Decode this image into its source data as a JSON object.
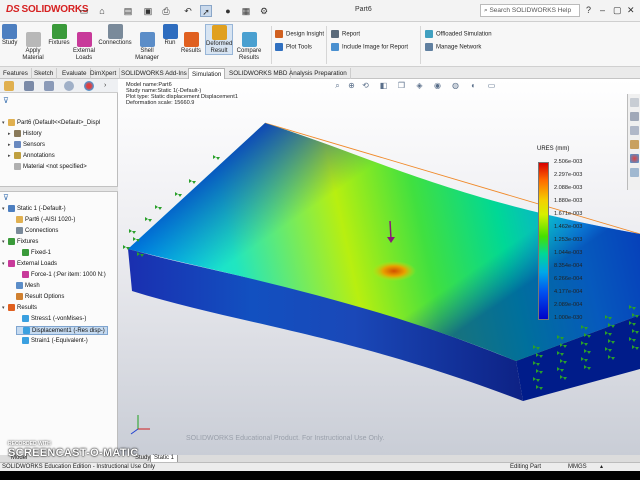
{
  "app": {
    "logo": "SOLIDWORKS",
    "doc_title": "Part6",
    "search_placeholder": "Search SOLIDWORKS Help"
  },
  "ribbon": {
    "large": [
      {
        "label": "Study",
        "icon": "study-icon",
        "color": "#4d7fc0"
      },
      {
        "label": "Apply Material",
        "icon": "apply-material-icon",
        "color": "#b8b8b8"
      },
      {
        "label": "Fixtures",
        "icon": "fixtures-icon",
        "color": "#3a9a3a"
      },
      {
        "label": "External Loads",
        "icon": "external-loads-icon",
        "color": "#c83a9a"
      },
      {
        "label": "Connections",
        "icon": "connections-icon",
        "color": "#7a8a9a"
      },
      {
        "label": "Shell Manager",
        "icon": "shell-manager-icon",
        "color": "#5b8dc8"
      },
      {
        "label": "Run",
        "icon": "run-icon",
        "color": "#2e6dbf"
      },
      {
        "label": "Results",
        "icon": "results-icon",
        "color": "#e06020"
      },
      {
        "label": "Deformed Result",
        "icon": "deformed-result-icon",
        "color": "#e0a020"
      },
      {
        "label": "Compare Results",
        "icon": "compare-results-icon",
        "color": "#4aa0d0"
      }
    ],
    "small": [
      {
        "label": "Design Insight",
        "icon": "design-insight-icon",
        "color": "#d06020"
      },
      {
        "label": "Plot Tools",
        "icon": "plot-tools-icon",
        "color": "#3070c0"
      },
      {
        "label": "Report",
        "icon": "report-icon",
        "color": "#5a6a7a"
      },
      {
        "label": "Include Image for Report",
        "icon": "include-image-icon",
        "color": "#4a90d0"
      },
      {
        "label": "Offloaded Simulation",
        "icon": "offloaded-simulation-icon",
        "color": "#40a0c0"
      },
      {
        "label": "Manage Network",
        "icon": "manage-network-icon",
        "color": "#6080a0"
      }
    ]
  },
  "command_tabs": [
    "Features",
    "Sketch",
    "Evaluate",
    "DimXpert",
    "SOLIDWORKS Add-Ins",
    "Simulation",
    "SOLIDWORKS MBD",
    "Analysis Preparation"
  ],
  "active_command_tab": "Simulation",
  "tree_top": [
    {
      "label": "Part6  (Default<<Default>_Displ",
      "icon": "part-icon",
      "color": "#e0b050"
    },
    {
      "label": "History",
      "icon": "history-icon",
      "color": "#8a7a5a"
    },
    {
      "label": "Sensors",
      "icon": "sensors-icon",
      "color": "#6a8ac0"
    },
    {
      "label": "Annotations",
      "icon": "annotations-icon",
      "color": "#c0a040"
    },
    {
      "label": "Material <not specified>",
      "icon": "material-icon",
      "color": "#b0b0b0"
    }
  ],
  "tree_sim": [
    {
      "label": "Static 1 (-Default-)",
      "icon": "study-icon",
      "color": "#4d7fc0"
    },
    {
      "label": "Part6 (-AISI 1020-)",
      "icon": "part-icon",
      "color": "#e0b050"
    },
    {
      "label": "Connections",
      "icon": "connections-icon",
      "color": "#7a8a9a"
    },
    {
      "label": "Fixtures",
      "icon": "fixtures-icon",
      "color": "#3a9a3a"
    },
    {
      "label": "Fixed-1",
      "icon": "fixed-icon",
      "color": "#3a9a3a"
    },
    {
      "label": "External Loads",
      "icon": "external-loads-icon",
      "color": "#c83a9a"
    },
    {
      "label": "Force-1 (:Per item: 1000 N:)",
      "icon": "force-icon",
      "color": "#c83a9a"
    },
    {
      "label": "Mesh",
      "icon": "mesh-icon",
      "color": "#5b8dc8"
    },
    {
      "label": "Result Options",
      "icon": "result-options-icon",
      "color": "#d08030"
    },
    {
      "label": "Results",
      "icon": "results-icon",
      "color": "#e06020"
    },
    {
      "label": "Stress1 (-vonMises-)",
      "icon": "plot-icon",
      "color": "#3aa0e0"
    },
    {
      "label": "Displacement1 (-Res disp-)",
      "icon": "plot-icon",
      "color": "#3aa0e0"
    },
    {
      "label": "Strain1 (-Equivalent-)",
      "icon": "plot-icon",
      "color": "#3aa0e0"
    }
  ],
  "viewport": {
    "info": [
      "Model name:Part6",
      "Study name:Static 1(-Default-)",
      "Plot type: Static displacement Displacement1",
      "Deformation scale: 15660.9"
    ],
    "legend_title": "URES (mm)",
    "legend_values": [
      "2.506e-003",
      "2.297e-003",
      "2.088e-003",
      "1.880e-003",
      "1.671e-003",
      "1.462e-003",
      "1.253e-003",
      "1.044e-003",
      "8.354e-004",
      "6.266e-004",
      "4.177e-004",
      "2.089e-004",
      "1.000e-030"
    ],
    "watermark": "SOLIDWORKS Educational Product. For Instructional Use Only."
  },
  "model_tabs": [
    "Model",
    "Study 1",
    "Static 1"
  ],
  "active_model_tab": "Static 1",
  "statusbar": {
    "left": "SOLIDWORKS Education Edition - Instructional Use Only",
    "mode": "Editing Part",
    "units": "MMGS"
  },
  "recorder": {
    "recorded": "RECORDED WITH",
    "brand": "SCREENCAST-O-MATIC"
  },
  "colors": {
    "accent": "#d62121",
    "selection": "#c5daf0"
  }
}
